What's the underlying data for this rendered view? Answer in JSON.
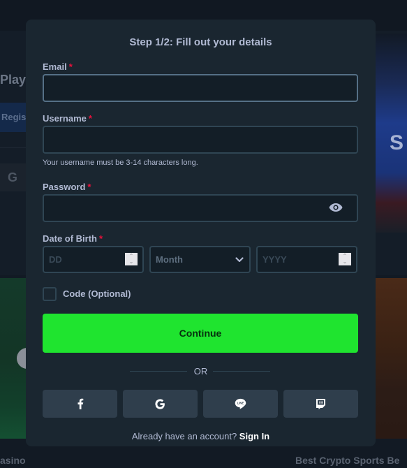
{
  "background": {
    "play_heading": "Play",
    "register_button": "Regis",
    "google_icon": "G",
    "casino_caption": "asino",
    "sports_caption": "Best Crypto Sports Be"
  },
  "modal": {
    "title": "Step 1/2: Fill out your details",
    "required_marker": "*",
    "email": {
      "label": "Email",
      "value": "",
      "placeholder": ""
    },
    "username": {
      "label": "Username",
      "value": "",
      "placeholder": "",
      "hint": "Your username must be 3-14 characters long."
    },
    "password": {
      "label": "Password",
      "value": "",
      "placeholder": "",
      "toggle_icon": "eye-icon"
    },
    "dob": {
      "label": "Date of Birth",
      "day_placeholder": "DD",
      "month_selected": "Month",
      "year_placeholder": "YYYY"
    },
    "code": {
      "label": "Code (Optional)",
      "checked": false
    },
    "continue_label": "Continue",
    "or_label": "OR",
    "social": [
      {
        "name": "facebook",
        "icon": "facebook-icon"
      },
      {
        "name": "google",
        "icon": "google-icon"
      },
      {
        "name": "line",
        "icon": "line-icon"
      },
      {
        "name": "twitch",
        "icon": "twitch-icon"
      }
    ],
    "signin_prompt": "Already have an account?",
    "signin_link": "Sign In"
  },
  "colors": {
    "accent_green": "#1fe42f",
    "required_red": "#e9113c",
    "modal_bg": "#1a2630",
    "input_bg": "#131e27",
    "border": "#2f4553"
  }
}
